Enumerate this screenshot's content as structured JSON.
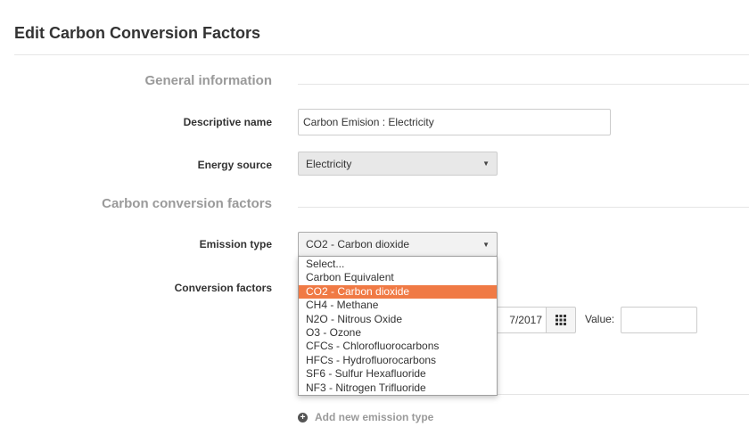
{
  "page": {
    "title": "Edit Carbon Conversion Factors"
  },
  "general_section": {
    "heading": "General information"
  },
  "descriptive_name": {
    "label": "Descriptive name",
    "value": "Carbon Emision : Electricity"
  },
  "energy_source": {
    "label": "Energy source",
    "selected": "Electricity"
  },
  "carbon_section": {
    "heading": "Carbon conversion factors"
  },
  "emission_type": {
    "label": "Emission type",
    "selected": "CO2 - Carbon dioxide",
    "options": [
      "Select...",
      "Carbon Equivalent",
      "CO2 - Carbon dioxide",
      "CH4 - Methane",
      "N2O - Nitrous Oxide",
      "O3 - Ozone",
      "CFCs - Chlorofluorocarbons",
      "HFCs - Hydrofluorocarbons",
      "SF6 - Sulfur Hexafluoride",
      "NF3 - Nitrogen Trifluoride"
    ],
    "highlighted_index": 2
  },
  "conversion_factors": {
    "label": "Conversion factors",
    "date_visible_text": "7/2017",
    "value_label": "Value:",
    "value": ""
  },
  "add_emission": {
    "label": "Add new emission type"
  },
  "colors": {
    "highlight": "#f07a45",
    "section_heading": "#9a9a9a"
  }
}
